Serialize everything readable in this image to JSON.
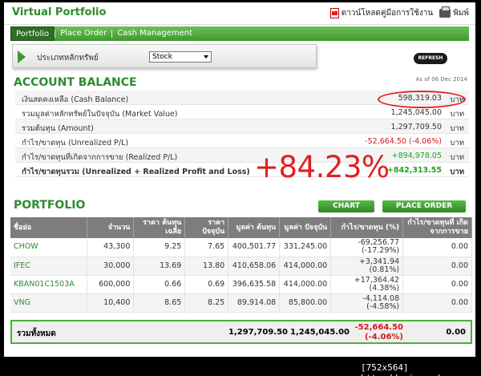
{
  "header": {
    "title": "Virtual Portfolio",
    "download_manual": "ดาวน์โหลดคู่มือการใช้งาน",
    "print": "พิมพ์"
  },
  "nav": {
    "tabs": [
      {
        "label": "Portfolio",
        "active": true
      },
      {
        "label": "Place Order"
      },
      {
        "label": "Cash Management"
      }
    ]
  },
  "filter": {
    "label": "ประเภทหลักทรัพย์",
    "selected": "Stock",
    "refresh": "REFRESH"
  },
  "account": {
    "title": "ACCOUNT BALANCE",
    "as_of": "As of 06 Dec 2014",
    "rows": [
      {
        "label": "เงินสดคงเหลือ (Cash Balance)",
        "value": "598,319.03",
        "unit": "บาท"
      },
      {
        "label": "รวมมูลค่าหลักทรัพย์ในปัจจุบัน (Market Value)",
        "value": "1,245,045.00",
        "unit": "บาท"
      },
      {
        "label": "รวมต้นทุน (Amount)",
        "value": "1,297,709.50",
        "unit": "บาท"
      },
      {
        "label": "กำไร/ขาดทุน (Unrealized P/L)",
        "value": "-52,664.50 (-4.06%)",
        "unit": "บาท"
      },
      {
        "label": "กำไร/ขาดทุนที่เกิดจากการขาย (Realized P/L)",
        "value": "+894,978.05",
        "unit": "บาท"
      },
      {
        "label": "กำไร/ขาดทุนรวม (Unrealized + Realized Profit and Loss)",
        "value": "+842,313.55",
        "unit": "บาท"
      }
    ],
    "highlight_pct": "+84.23%"
  },
  "portfolio": {
    "title": "PORTFOLIO",
    "chart_btn": "CHART",
    "order_btn": "PLACE ORDER",
    "columns": [
      "ชื่อย่อ",
      "จำนวน",
      "ราคา ต้นทุนเฉลี่ย",
      "ราคา ปัจจุบัน",
      "มูลค่า ต้นทุน",
      "มูลค่า ปัจจุบัน",
      "กำไร/ขาดทุน (%)",
      "กำไร/ขาดทุนที่ เกิดจากการขาย"
    ],
    "rows": [
      {
        "symbol": "CHOW",
        "qty": "43,300",
        "avg_cost": "9.25",
        "price": "7.65",
        "cost_value": "400,501.77",
        "market_value": "331,245.00",
        "pl": "-69,256.77",
        "pl_pct": "(-17.29%)",
        "realized": "0.00"
      },
      {
        "symbol": "IFEC",
        "qty": "30,000",
        "avg_cost": "13.69",
        "price": "13.80",
        "cost_value": "410,658.06",
        "market_value": "414,000.00",
        "pl": "+3,341.94",
        "pl_pct": "(0.81%)",
        "realized": "0.00"
      },
      {
        "symbol": "KBAN01C1503A",
        "qty": "600,000",
        "avg_cost": "0.66",
        "price": "0.69",
        "cost_value": "396,635.58",
        "market_value": "414,000.00",
        "pl": "+17,364.42",
        "pl_pct": "(4.38%)",
        "realized": "0.00"
      },
      {
        "symbol": "VNG",
        "qty": "10,400",
        "avg_cost": "8.65",
        "price": "8.25",
        "cost_value": "89,914.08",
        "market_value": "85,800.00",
        "pl": "-4,114.08",
        "pl_pct": "(-4.58%)",
        "realized": "0.00"
      }
    ],
    "total": {
      "label": "รวมทั้งหมด",
      "cost_value": "1,297,709.50",
      "market_value": "1,245,045.00",
      "pl": "-52,664.50",
      "pl_pct": "(-4.06%)",
      "realized": "0.00"
    }
  },
  "watermark": "[752x564] http://upic.me/"
}
